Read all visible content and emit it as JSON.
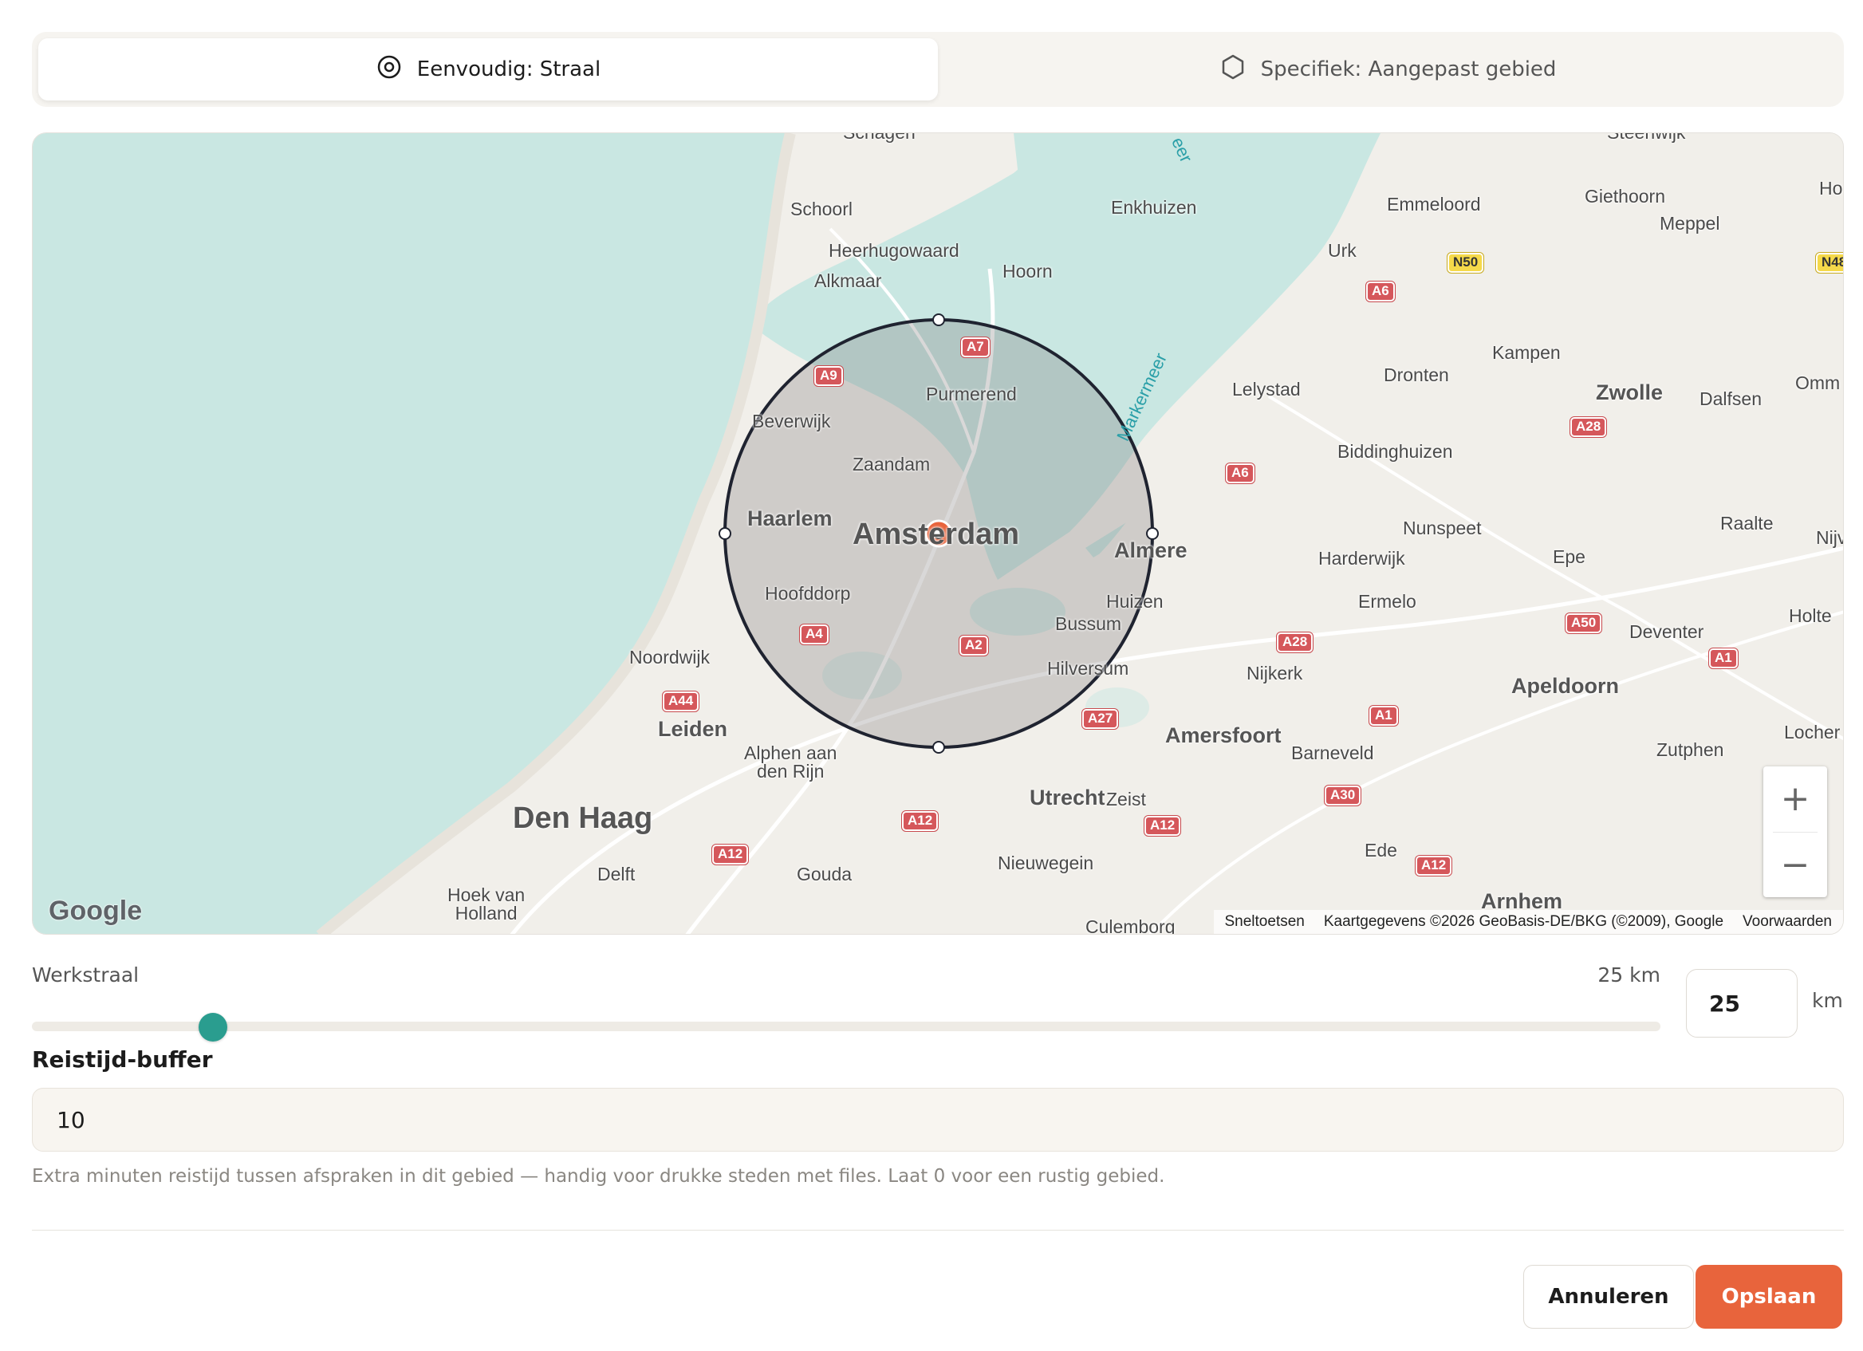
{
  "tabs": [
    {
      "label": "Eenvoudig: Straal",
      "icon": "radius-target-icon",
      "active": true
    },
    {
      "label": "Specifiek: Aangepast gebied",
      "icon": "hexagon-icon",
      "active": false
    }
  ],
  "map": {
    "places": {
      "schagen": "Schagen",
      "steenwijk": "Steenwijk",
      "schoorl": "Schoorl",
      "enkhuizen": "Enkhuizen",
      "emmeloord": "Emmeloord",
      "giethoorn": "Giethoorn",
      "ho": "Ho",
      "meppel": "Meppel",
      "heerhugowaard": "Heerhugowaard",
      "urk": "Urk",
      "alkmaar": "Alkmaar",
      "hoorn": "Hoorn",
      "kampen": "Kampen",
      "purmerend": "Purmerend",
      "lelystad": "Lelystad",
      "dronten": "Dronten",
      "zwolle": "Zwolle",
      "dalfsen": "Dalfsen",
      "omm": "Omm",
      "beverwijk": "Beverwijk",
      "zaandam": "Zaandam",
      "biddinghuizen": "Biddinghuizen",
      "haarlem": "Haarlem",
      "amsterdam": "Amsterdam",
      "almere": "Almere",
      "nunspeet": "Nunspeet",
      "raalte": "Raalte",
      "nijv": "Nijv",
      "harderwijk": "Harderwijk",
      "epe": "Epe",
      "hoofddorp": "Hoofddorp",
      "huizen": "Huizen",
      "ermelo": "Ermelo",
      "bussum": "Bussum",
      "holte": "Holte",
      "deventer": "Deventer",
      "noordwijk": "Noordwijk",
      "hilversum": "Hilversum",
      "nijkerk": "Nijkerk",
      "apeldoorn": "Apeldoorn",
      "leiden": "Leiden",
      "amersfoort": "Amersfoort",
      "locher": "Locher",
      "alphen": "Alphen aan\nden Rijn",
      "barneveld": "Barneveld",
      "zutphen": "Zutphen",
      "utrecht": "Utrecht",
      "zeist": "Zeist",
      "denhaag": "Den Haag",
      "ede": "Ede",
      "nieuwegein": "Nieuwegein",
      "delft": "Delft",
      "gouda": "Gouda",
      "arnhem": "Arnhem",
      "hoekvanholland": "Hoek van\nHolland",
      "culemborg": "Culemborg",
      "markermeer": "Markermeer",
      "ijsselmeer": "eer"
    },
    "roads": {
      "a7": "A7",
      "a9": "A9",
      "a6_north": "A6",
      "n50": "N50",
      "n48": "N48",
      "a6": "A6",
      "a28_zwolle": "A28",
      "a4": "A4",
      "a2": "A2",
      "a28": "A28",
      "a50": "A50",
      "a1_dev": "A1",
      "a44": "A44",
      "a27": "A27",
      "a1": "A1",
      "a30": "A30",
      "a12_u": "A12",
      "a12_z": "A12",
      "a12_dh": "A12",
      "a12_e": "A12"
    },
    "zoom_in": "+",
    "zoom_out": "−",
    "google": "Google",
    "attribution": {
      "shortcuts": "Sneltoetsen",
      "data": "Kaartgegevens ©2026 GeoBasis-DE/BKG (©2009), Google",
      "terms": "Voorwaarden"
    },
    "radius_km": 25,
    "center": "Amsterdam"
  },
  "radius": {
    "label": "Werkstraal",
    "display": "25 km",
    "value": "25",
    "unit": "km",
    "min_km": 5,
    "max_km": 200,
    "slider_value_km": 25
  },
  "buffer": {
    "label": "Reistijd-buffer",
    "value": "10",
    "hint": "Extra minuten reistijd tussen afspraken in dit gebied — handig voor drukke steden met files. Laat 0 voor een rustig gebied."
  },
  "actions": {
    "cancel": "Annuleren",
    "save": "Opslaan"
  },
  "colors": {
    "accent": "#e8643c",
    "slider": "#2a9d8f",
    "water": "#c9e7e2",
    "land": "#f1efea"
  }
}
